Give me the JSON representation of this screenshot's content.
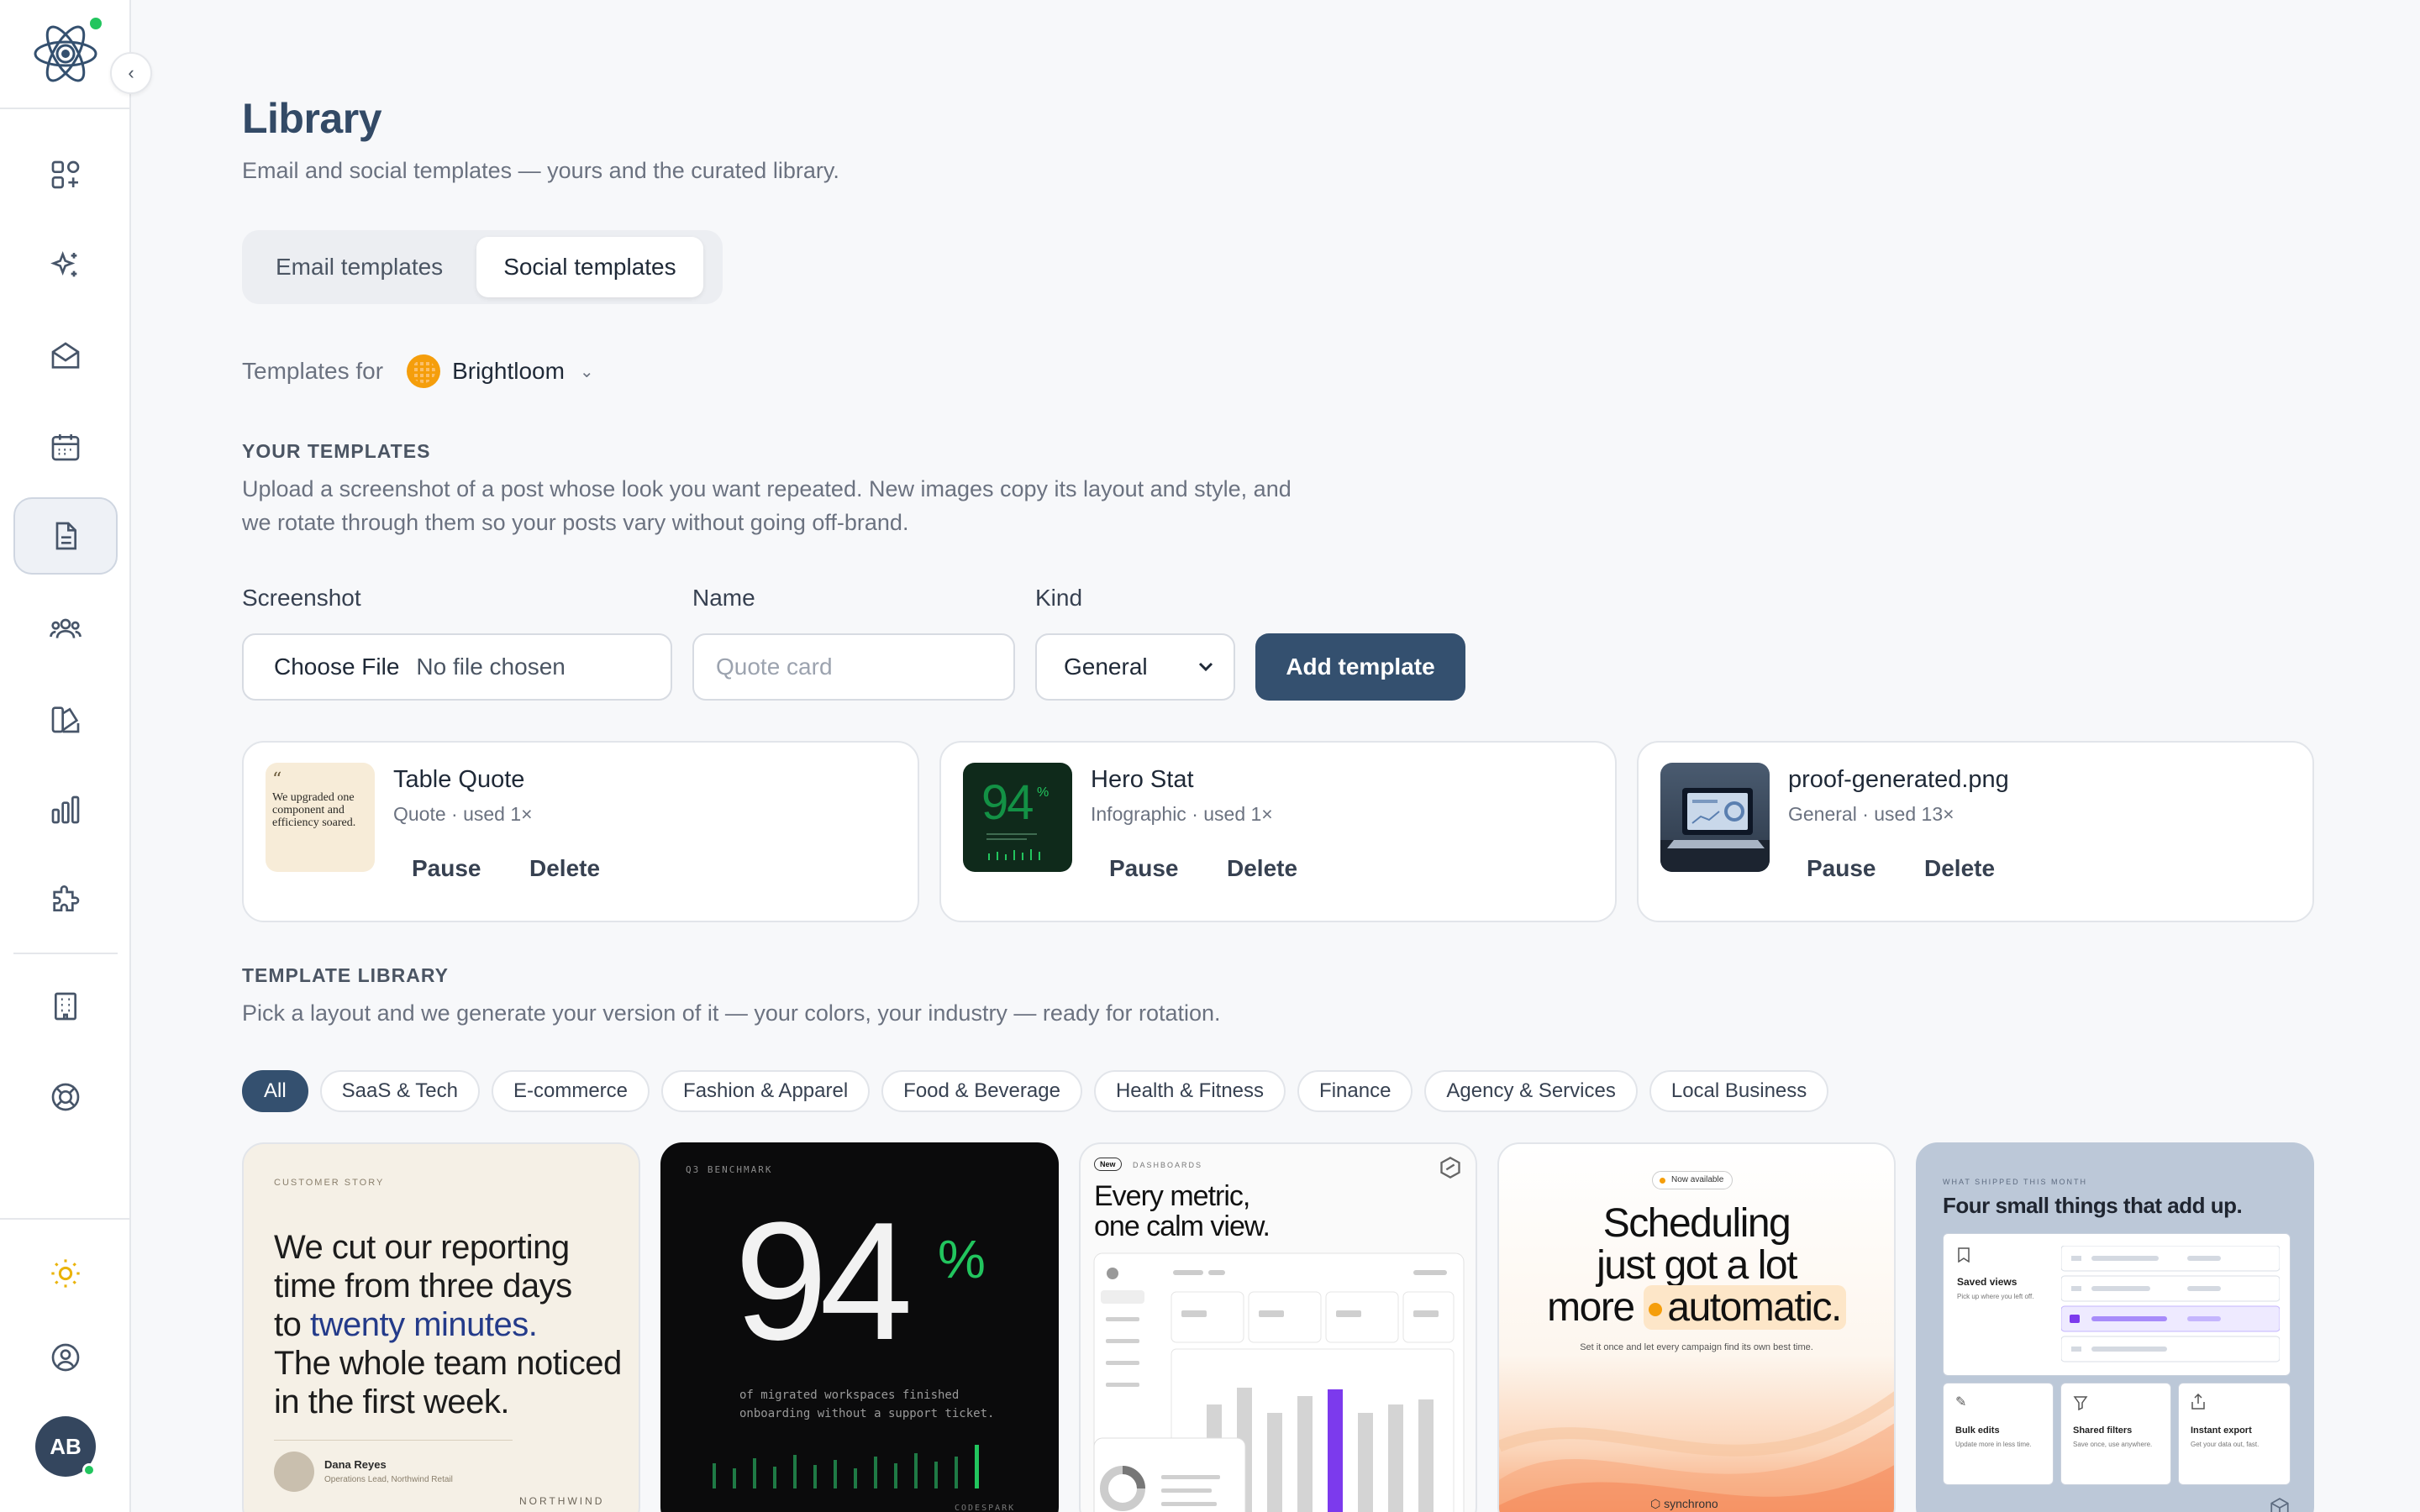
{
  "sidebar": {
    "avatar_initials": "AB",
    "icons": [
      "dashboard-icon",
      "sparkles-icon",
      "inbox-icon",
      "calendar-icon",
      "document-icon",
      "users-icon",
      "palette-icon",
      "bar-chart-icon",
      "puzzle-icon",
      "building-icon",
      "support-icon",
      "sun-icon",
      "user-circle-icon"
    ]
  },
  "page": {
    "title": "Library",
    "subtitle": "Email and social templates — yours and the curated library."
  },
  "tabs": [
    {
      "label": "Email templates",
      "active": false
    },
    {
      "label": "Social templates",
      "active": true
    }
  ],
  "templates_for": {
    "label": "Templates for",
    "brand": "Brightloom"
  },
  "your_templates": {
    "title": "YOUR TEMPLATES",
    "desc_line1": "Upload a screenshot of a post whose look you want repeated. New images copy its layout and style, and",
    "desc_line2": "we rotate through them so your posts vary without going off-brand."
  },
  "form": {
    "screenshot_label": "Screenshot",
    "file_button": "Choose File",
    "file_status": "No file chosen",
    "name_label": "Name",
    "name_placeholder": "Quote card",
    "kind_label": "Kind",
    "kind_value": "General",
    "add_button": "Add template"
  },
  "templates": [
    {
      "name": "Table Quote",
      "meta": "Quote · used 1×",
      "pause": "Pause",
      "delete": "Delete"
    },
    {
      "name": "Hero Stat",
      "meta": "Infographic · used 1×",
      "pause": "Pause",
      "delete": "Delete"
    },
    {
      "name": "proof-generated.png",
      "meta": "General · used 13×",
      "pause": "Pause",
      "delete": "Delete"
    }
  ],
  "template_thumbs": {
    "quote_text": "We upgraded one component and efficiency soared.",
    "stat_value": "94"
  },
  "library": {
    "title": "TEMPLATE LIBRARY",
    "desc": "Pick a layout and we generate your version of it — your colors, your industry — ready for rotation.",
    "filters": [
      "All",
      "SaaS & Tech",
      "E-commerce",
      "Fashion & Apparel",
      "Food & Beverage",
      "Health & Fitness",
      "Finance",
      "Agency & Services",
      "Local Business"
    ],
    "active_filter": "All",
    "cards": {
      "story": {
        "eyebrow": "CUSTOMER STORY",
        "line1": "We cut our reporting",
        "line2": "time from three days",
        "line3_a": "to ",
        "line3_b": "twenty minutes.",
        "line4": "The whole team noticed",
        "line5": "in the first week.",
        "person": "Dana Reyes",
        "role": "Operations Lead, Northwind Retail",
        "brand": "NORTHWIND"
      },
      "benchmark": {
        "eyebrow": "Q3 BENCHMARK",
        "value": "94",
        "unit": "%",
        "desc1": "of migrated workspaces finished",
        "desc2": "onboarding without a support ticket.",
        "brand": "CODESPARK"
      },
      "dashboard": {
        "badge": "New",
        "eyebrow": "DASHBOARDS",
        "head1": "Every metric,",
        "head2": "one calm view."
      },
      "scheduling": {
        "badge": "Now available",
        "line1": "Scheduling",
        "line2": "just got a lot",
        "line3_a": "more",
        "line3_b": "automatic.",
        "sub": "Set it once and let every campaign find its own best time.",
        "brand": "synchrono"
      },
      "shipped": {
        "eyebrow": "WHAT SHIPPED THIS MONTH",
        "title": "Four small things that add up.",
        "f1": "Saved views",
        "f1d": "Pick up where you left off.",
        "f2": "Bulk edits",
        "f2d": "Update more in less time.",
        "f3": "Shared filters",
        "f3d": "Save once, use anywhere.",
        "f4": "Instant export",
        "f4d": "Get your data out, fast."
      }
    }
  },
  "colors": {
    "primary": "#34506f",
    "title": "#334a66",
    "online": "#22c55e",
    "accent_purple": "#7c3aed",
    "accent_green": "#22c55e"
  }
}
